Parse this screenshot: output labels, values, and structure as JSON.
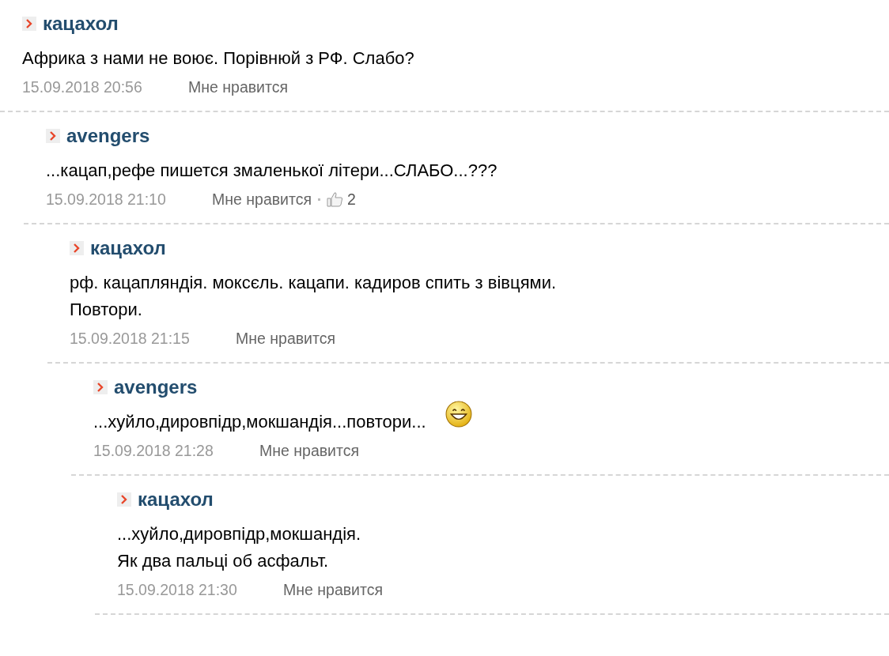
{
  "comments": [
    {
      "author": "кацахол",
      "lines": [
        "Африка з нами не воює. Порівнюй з РФ. Слабо?"
      ],
      "date": "15.09.2018 20:56",
      "like": "Мне нравится",
      "children": [
        {
          "author": "avengers",
          "lines": [
            "...кацап,рефе пишется змаленької літери...СЛАБО...???"
          ],
          "date": "15.09.2018 21:10",
          "like": "Мне нравится",
          "likes": "2",
          "children": [
            {
              "author": "кацахол",
              "lines": [
                "рф. кацапляндія. моксєль. кацапи. кадиров спить з вівцями.",
                "Повтори."
              ],
              "date": "15.09.2018 21:15",
              "like": "Мне нравится",
              "children": [
                {
                  "author": "avengers",
                  "lines": [
                    "...хуйло,дировпідр,мокшандія...повтори..."
                  ],
                  "emoticon": true,
                  "date": "15.09.2018 21:28",
                  "like": "Мне нравится",
                  "children": [
                    {
                      "author": "кацахол",
                      "lines": [
                        "...хуйло,дировпідр,мокшандія.",
                        "Як два пальці об асфальт."
                      ],
                      "date": "15.09.2018 21:30",
                      "like": "Мне нравится"
                    }
                  ]
                }
              ]
            }
          ]
        }
      ]
    }
  ]
}
